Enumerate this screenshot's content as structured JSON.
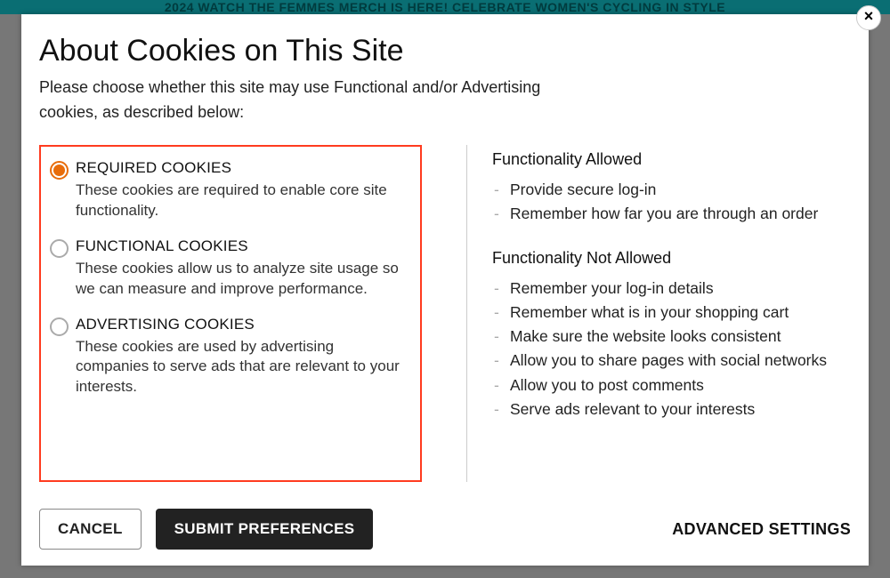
{
  "banner": "2024 WATCH THE FEMMES MERCH IS HERE! CELEBRATE WOMEN'S CYCLING IN STYLE",
  "modal": {
    "title": "About Cookies on This Site",
    "intro": "Please choose whether this site may use Functional and/or Advertising cookies, as described below:",
    "options": [
      {
        "title": "REQUIRED COOKIES",
        "desc": "These cookies are required to enable core site functionality.",
        "selected": true
      },
      {
        "title": "FUNCTIONAL COOKIES",
        "desc": "These cookies allow us to analyze site usage so we can measure and improve performance.",
        "selected": false
      },
      {
        "title": "ADVERTISING COOKIES",
        "desc": "These cookies are used by advertising companies to serve ads that are relevant to your interests.",
        "selected": false
      }
    ],
    "allowed_title": "Functionality Allowed",
    "allowed": [
      "Provide secure log-in",
      "Remember how far you are through an order"
    ],
    "not_allowed_title": "Functionality Not Allowed",
    "not_allowed": [
      "Remember your log-in details",
      "Remember what is in your shopping cart",
      "Make sure the website looks consistent",
      "Allow you to share pages with social networks",
      "Allow you to post comments",
      "Serve ads relevant to your interests"
    ],
    "cancel": "CANCEL",
    "submit": "SUBMIT PREFERENCES",
    "advanced": "ADVANCED SETTINGS",
    "close": "×"
  }
}
